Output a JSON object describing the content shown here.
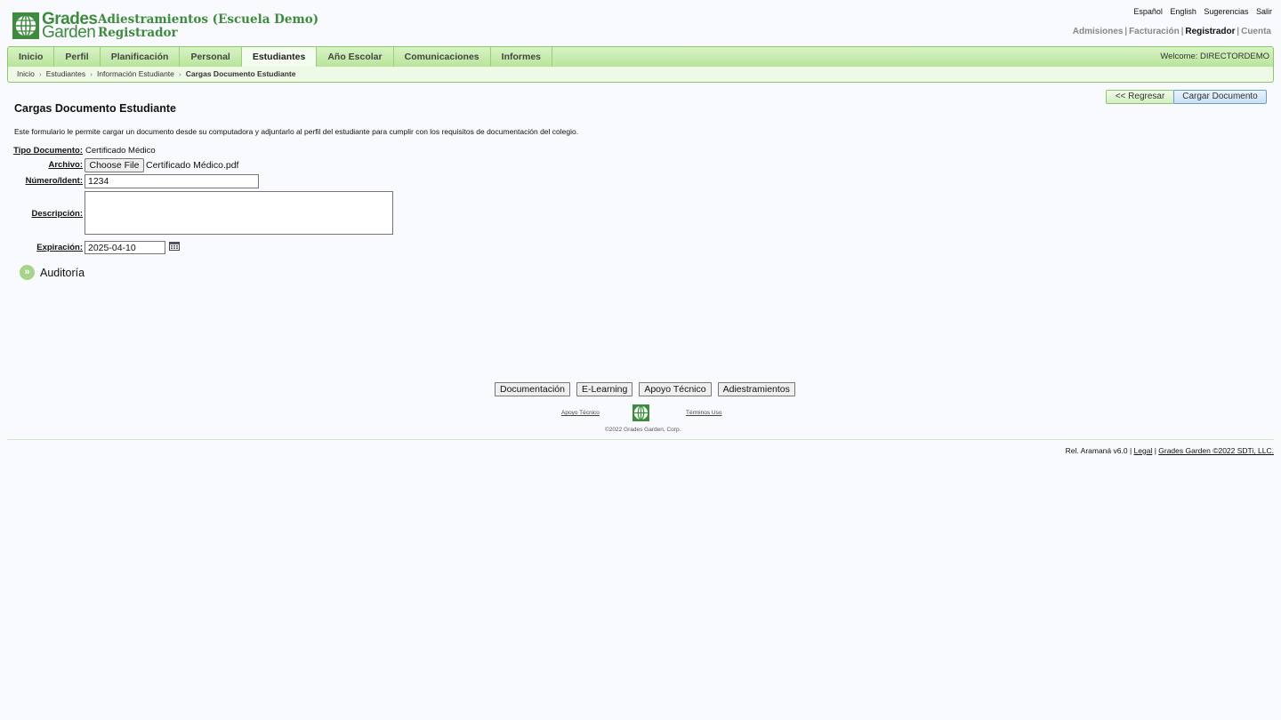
{
  "header": {
    "logo_line1": "Grades",
    "logo_line2": "Garden",
    "school_name": "Adiestramientos (Escuela Demo)",
    "module_name": "Registrador",
    "top_links": [
      "Español",
      "English",
      "Sugerencias",
      "Salir"
    ],
    "modules": [
      "Admisiones",
      "Facturación",
      "Registrador",
      "Cuenta"
    ],
    "active_module": "Registrador",
    "brand_color": "#3e8a3e"
  },
  "nav": {
    "tabs": [
      "Inicio",
      "Perfil",
      "Planificación",
      "Personal",
      "Estudiantes",
      "Año Escolar",
      "Comunicaciones",
      "Informes"
    ],
    "active_tab": "Estudiantes",
    "welcome": "Welcome: DIRECTORDEMO",
    "breadcrumb": [
      "Inicio",
      "Estudiantes",
      "Información Estudiante",
      "Cargas Documento Estudiante"
    ]
  },
  "actions": {
    "back_label": "<< Regresar",
    "upload_label": "Cargar Documento"
  },
  "page": {
    "title": "Cargas Documento Estudiante",
    "intro": "Este formulario le permite cargar un documento desde su computadora y adjuntarlo al perfil del estudiante para cumplir con los requisitos de documentación del colegio."
  },
  "form": {
    "doc_type_label": "Tipo Documento:",
    "doc_type_value": "Certificado Médico",
    "file_label": "Archivo:",
    "choose_file_label": "Choose File",
    "file_name": "Certificado Médico.pdf",
    "number_label": "Número/Ident:",
    "number_value": "1234",
    "description_label": "Descripción:",
    "description_value": "",
    "expiration_label": "Expiración:",
    "expiration_value": "2025-04-10"
  },
  "audit": {
    "label": "Auditoría",
    "icon": "double-chevron-right-icon"
  },
  "footer": {
    "buttons": [
      "Documentación",
      "E-Learning",
      "Apoyo Técnico",
      "Adiestramientos"
    ],
    "link_support": "Apoyo Técnico",
    "link_terms": "Términos Uso",
    "copyright": "©2022 Grades Garden, Corp.",
    "release": "Rel. Aramaná v6.0",
    "legal": "Legal",
    "company": "Grades Garden ©2022 SDTi, LLC."
  }
}
